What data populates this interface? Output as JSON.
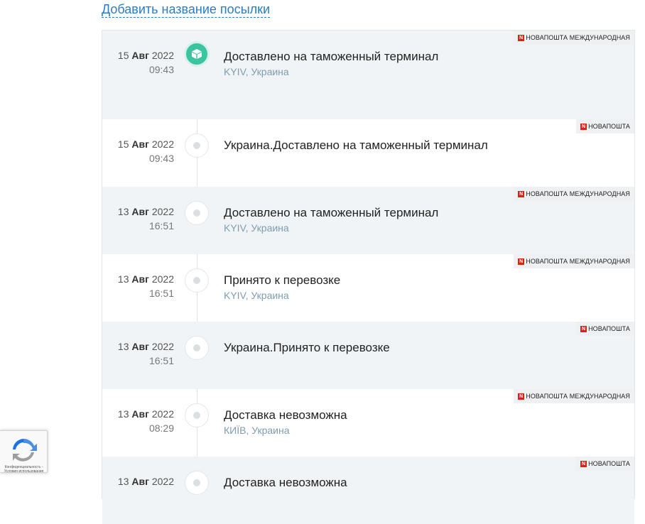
{
  "header": {
    "add_name_link": "Добавить название посылки"
  },
  "events": [
    {
      "day": "15",
      "month": "Авг",
      "year": "2022",
      "time": "09:43",
      "status": "Доставлено на таможенный терминал",
      "location": "KYIV, Украина",
      "carrier": "НОВАПОШТА МЕЖДУНАРОДНАЯ",
      "active": true
    },
    {
      "day": "15",
      "month": "Авг",
      "year": "2022",
      "time": "09:43",
      "status": "Украина.Доставлено на таможенный терминал",
      "location": "",
      "carrier": "НОВАПОШТА",
      "active": false
    },
    {
      "day": "13",
      "month": "Авг",
      "year": "2022",
      "time": "16:51",
      "status": "Доставлено на таможенный терминал",
      "location": "KYIV, Украина",
      "carrier": "НОВАПОШТА МЕЖДУНАРОДНАЯ",
      "active": false
    },
    {
      "day": "13",
      "month": "Авг",
      "year": "2022",
      "time": "16:51",
      "status": "Принято к перевозке",
      "location": "KYIV, Украина",
      "carrier": "НОВАПОШТА МЕЖДУНАРОДНАЯ",
      "active": false
    },
    {
      "day": "13",
      "month": "Авг",
      "year": "2022",
      "time": "16:51",
      "status": "Украина.Принято к перевозке",
      "location": "",
      "carrier": "НОВАПОШТА",
      "active": false
    },
    {
      "day": "13",
      "month": "Авг",
      "year": "2022",
      "time": "08:29",
      "status": "Доставка невозможна",
      "location": "КИЇВ, Украина",
      "carrier": "НОВАПОШТА МЕЖДУНАРОДНАЯ",
      "active": false
    },
    {
      "day": "13",
      "month": "Авг",
      "year": "2022",
      "time": "",
      "status": "Доставка невозможна",
      "location": "",
      "carrier": "НОВАПОШТА",
      "active": false
    }
  ],
  "recaptcha": {
    "text": "Конфиденциальность - Условия использования"
  },
  "colors": {
    "accent": "#3cc3a0",
    "link": "#2b7cc4",
    "location": "#7f9cae",
    "carrier_logo": "#d9221c"
  }
}
